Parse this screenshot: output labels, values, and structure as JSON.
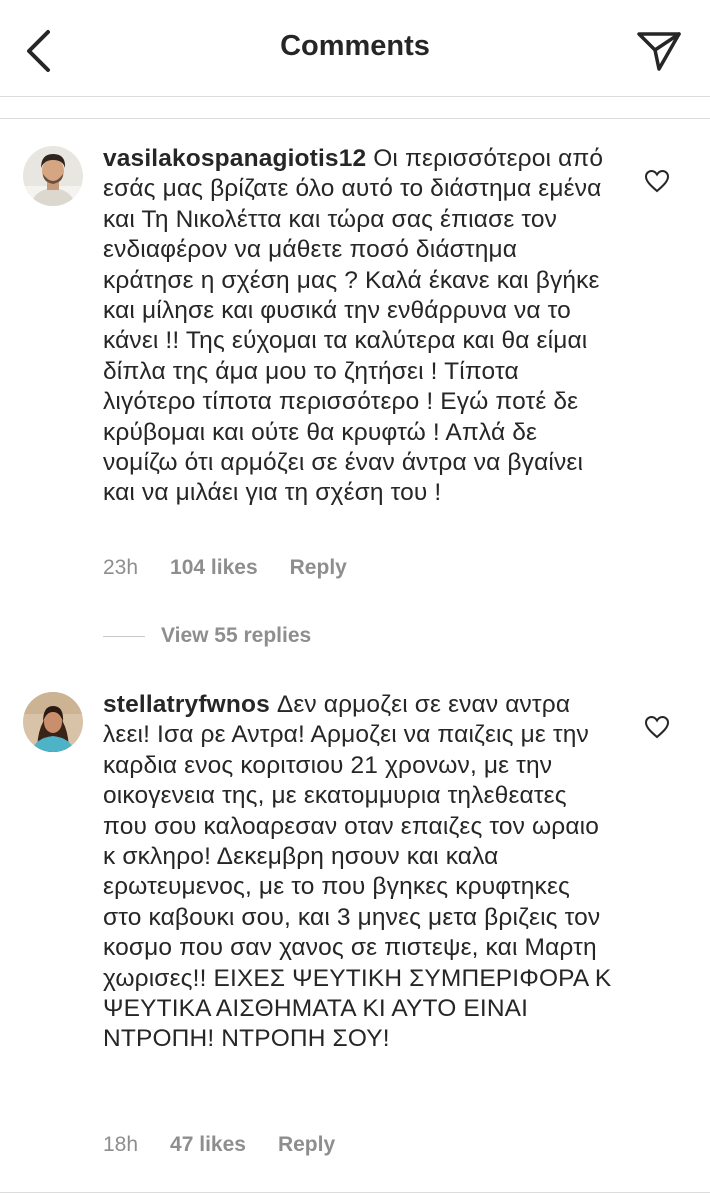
{
  "header": {
    "title": "Comments",
    "back_icon": "chevron-left-icon",
    "send_icon": "paper-plane-icon"
  },
  "comments": [
    {
      "username": "vasilakospanagiotis12",
      "text": "Οι περισσότεροι από εσάς μας βρίζατε όλο αυτό το διάστημα εμένα και Τη Νικολέττα και τώρα σας έπιασε τον ενδιαφέρον να μάθετε ποσό διάστημα κράτησε η σχέση μας ? Καλά έκανε και βγήκε και μίλησε και  φυσικά την ενθάρρυνα να το κάνει !! Της εύχομαι τα καλύτερα και θα είμαι δίπλα της άμα μου το ζητήσει ! Τίποτα λιγότερο τίποτα περισσότερο ! Εγώ ποτέ δε κρύβομαι και ούτε θα κρυφτώ ! Απλά δε νομίζω ότι αρμόζει σε έναν άντρα να βγαίνει και να μιλάει για τη σχέση του !",
      "time": "23h",
      "likes": "104 likes",
      "reply": "Reply",
      "view_replies": "View 55 replies"
    },
    {
      "username": "stellatryfwnos",
      "text": "Δεν αρμοζει σε εναν αντρα λεει! Ισα ρε Αντρα! Αρμοζει να παιζεις με την καρδια ενος κοριτσιου 21 χρονων, με την οικογενεια της, με εκατομμυρια τηλεθεατες που σου καλοαρεσαν οταν επαιζες τον ωραιο κ σκληρο!  Δεκεμβρη ησουν και καλα ερωτευμενος, με το που βγηκες κρυφτηκες στο καβουκι σου, και 3 μηνες μετα βριζεις τον κοσμο που σαν χανος σε πιστεψε, και Μαρτη χωρισες!! ΕΙΧΕΣ ΨΕΥΤΙΚΗ ΣΥΜΠΕΡΙΦΟΡΑ Κ ΨΕΥΤΙΚΑ ΑΙΣΘΗΜΑΤΑ ΚΙ ΑΥΤΟ ΕΙΝΑΙ ΝΤΡΟΠΗ! ΝΤΡΟΠΗ ΣΟΥ!",
      "time": "18h",
      "likes": "47 likes",
      "reply": "Reply"
    }
  ],
  "icons": {
    "heart": "heart-outline-icon"
  },
  "colors": {
    "text": "#262626",
    "secondary": "#8e8e8e",
    "divider": "#dbdbdb"
  }
}
